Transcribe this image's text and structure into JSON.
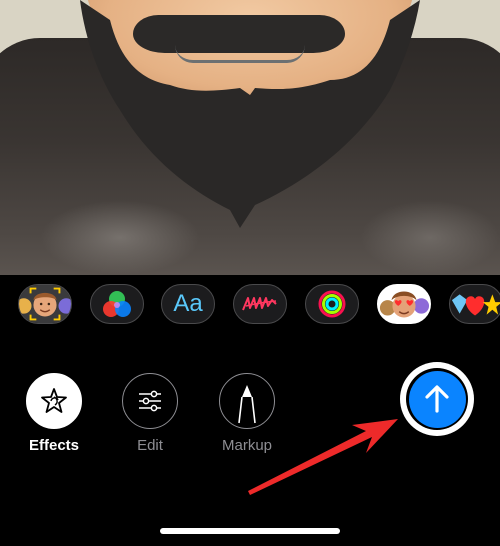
{
  "photo": {
    "description": "Camera preview with Memoji beard overlay"
  },
  "effects_strip": {
    "items": [
      {
        "name": "memoji",
        "icon": "memoji-face-icon"
      },
      {
        "name": "filters",
        "icon": "color-filters-icon"
      },
      {
        "name": "text",
        "icon": "text-icon",
        "label": "Aa"
      },
      {
        "name": "shapes",
        "icon": "scribble-shapes-icon"
      },
      {
        "name": "activity",
        "icon": "activity-rings-icon"
      },
      {
        "name": "memoji-stickers",
        "icon": "memoji-stickers-icon"
      },
      {
        "name": "emoji-stickers",
        "icon": "emoji-stickers-icon",
        "emoji": "💎❤️⭐"
      }
    ]
  },
  "actions": {
    "effects": {
      "label": "Effects",
      "icon": "star-effects-icon",
      "active": true
    },
    "edit": {
      "label": "Edit",
      "icon": "sliders-icon",
      "active": false
    },
    "markup": {
      "label": "Markup",
      "icon": "pen-markup-icon",
      "active": false
    }
  },
  "send_button": {
    "icon": "arrow-up-icon",
    "color": "#0a84ff"
  },
  "annotation": {
    "type": "arrow",
    "color": "#ee2a2a",
    "points_to": "send_button"
  },
  "colors": {
    "background": "#000000",
    "accent_blue": "#0a84ff",
    "text_blue": "#5ac8fa",
    "inactive_gray": "#8e8e93",
    "selection_yellow": "#ffcc00"
  }
}
